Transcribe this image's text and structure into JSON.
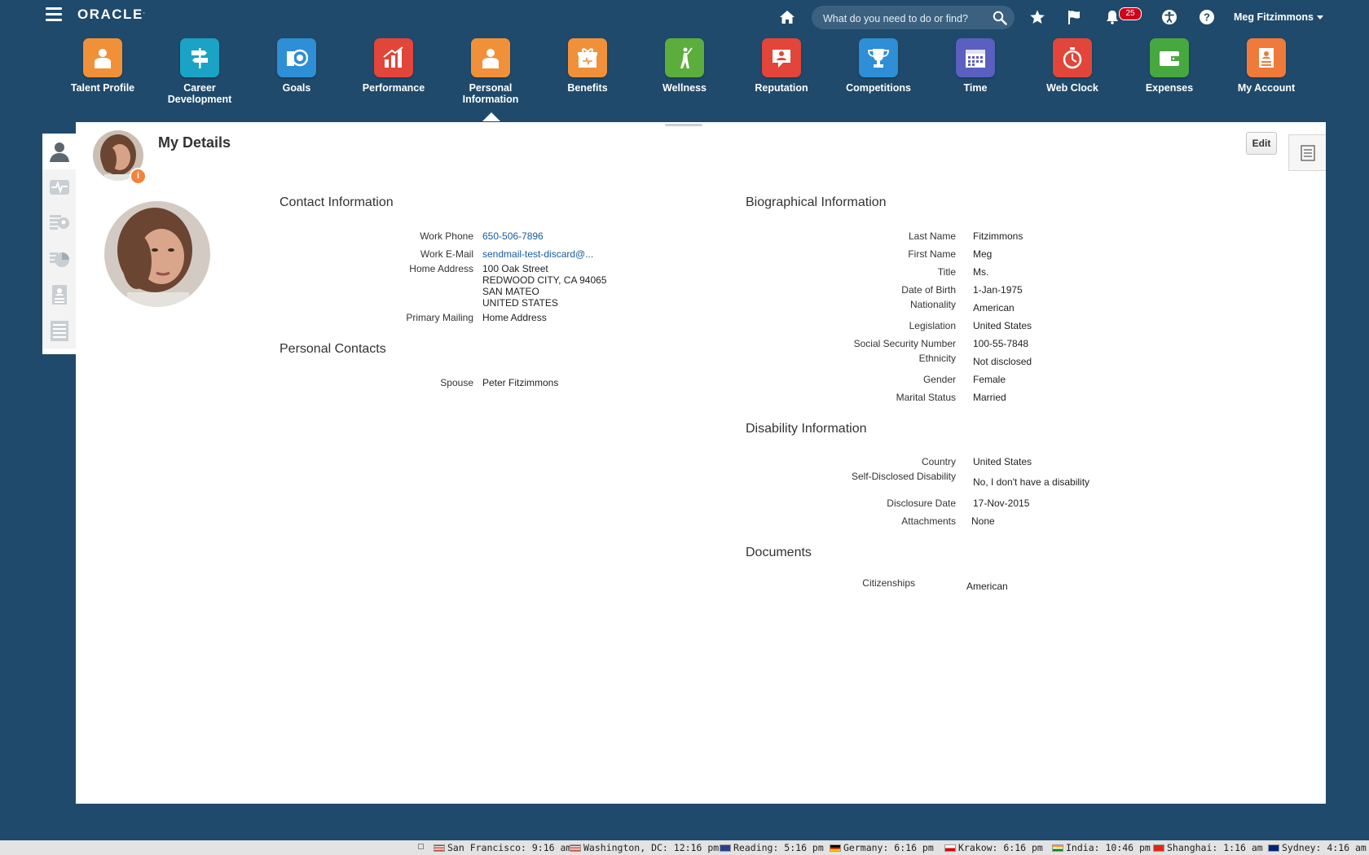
{
  "app": {
    "logo_text": "ORACLE",
    "search_placeholder": "What do you need to do or find?",
    "notification_count": "25",
    "user_name": "Meg Fitzimmons"
  },
  "springboard": [
    {
      "label": "Talent Profile",
      "color": "#f0913a",
      "icon": "person-badge-icon"
    },
    {
      "label": "Career Development",
      "color": "#1aa3c4",
      "icon": "signpost-icon"
    },
    {
      "label": "Goals",
      "color": "#2e8ed6",
      "icon": "target-icon"
    },
    {
      "label": "Performance",
      "color": "#e2453a",
      "icon": "bar-chart-icon"
    },
    {
      "label": "Personal Information",
      "color": "#f0913a",
      "icon": "person-card-icon"
    },
    {
      "label": "Benefits",
      "color": "#f0913a",
      "icon": "gift-icon"
    },
    {
      "label": "Wellness",
      "color": "#5cae3c",
      "icon": "golfer-icon"
    },
    {
      "label": "Reputation",
      "color": "#e2453a",
      "icon": "speech-person-icon"
    },
    {
      "label": "Competitions",
      "color": "#2e8ed6",
      "icon": "trophy-icon"
    },
    {
      "label": "Time",
      "color": "#5a5fc0",
      "icon": "calendar-icon"
    },
    {
      "label": "Web Clock",
      "color": "#e2453a",
      "icon": "stopwatch-icon"
    },
    {
      "label": "Expenses",
      "color": "#47a83f",
      "icon": "wallet-icon"
    },
    {
      "label": "My Account",
      "color": "#f07a3a",
      "icon": "id-badge-icon"
    }
  ],
  "active_tile": "Personal Information",
  "page": {
    "title": "My Details",
    "edit_label": "Edit",
    "info_badge": "i"
  },
  "contact": {
    "title": "Contact Information",
    "work_phone_label": "Work Phone",
    "work_phone": "650-506-7896",
    "work_email_label": "Work E-Mail",
    "work_email": "sendmail-test-discard@...",
    "home_address_label": "Home Address",
    "address_lines": [
      "100 Oak Street",
      "REDWOOD CITY, CA 94065",
      "SAN MATEO",
      "UNITED STATES"
    ],
    "primary_mailing_label": "Primary Mailing",
    "primary_mailing": "Home Address"
  },
  "personal_contacts": {
    "title": "Personal Contacts",
    "spouse_label": "Spouse",
    "spouse": "Peter Fitzimmons"
  },
  "bio": {
    "title": "Biographical Information",
    "rows": [
      {
        "label": "Last Name",
        "value": "Fitzimmons"
      },
      {
        "label": "First Name",
        "value": "Meg"
      },
      {
        "label": "Title",
        "value": "Ms."
      },
      {
        "label": "Date of Birth",
        "value": "1-Jan-1975"
      },
      {
        "label": "Nationality",
        "value": "American"
      },
      {
        "label": "Legislation",
        "value": "United States"
      },
      {
        "label": "Social Security Number",
        "value": "100-55-7848"
      },
      {
        "label": "Ethnicity",
        "value": "Not disclosed"
      },
      {
        "label": "Gender",
        "value": "Female"
      },
      {
        "label": "Marital Status",
        "value": "Married"
      }
    ]
  },
  "disability": {
    "title": "Disability Information",
    "rows": [
      {
        "label": "Country",
        "value": "United States"
      },
      {
        "label": "Self-Disclosed Disability",
        "value": "No, I don't have a disability"
      },
      {
        "label": "Disclosure Date",
        "value": "17-Nov-2015"
      },
      {
        "label": "Attachments",
        "value": "None"
      }
    ]
  },
  "documents": {
    "title": "Documents",
    "citizenships_label": "Citizenships",
    "citizenships": "American"
  },
  "clocks": [
    {
      "text": "San Francisco: 9:16 am",
      "flag": "us"
    },
    {
      "text": "Washington, DC: 12:16 pm",
      "flag": "us"
    },
    {
      "text": "Reading: 5:16 pm",
      "flag": "uk"
    },
    {
      "text": "Germany: 6:16 pm",
      "flag": "de"
    },
    {
      "text": "Krakow: 6:16 pm",
      "flag": "pl"
    },
    {
      "text": "India: 10:46 pm",
      "flag": "in"
    },
    {
      "text": "Shanghai: 1:16 am",
      "flag": "cn"
    },
    {
      "text": "Sydney: 4:16 am",
      "flag": "au"
    }
  ]
}
